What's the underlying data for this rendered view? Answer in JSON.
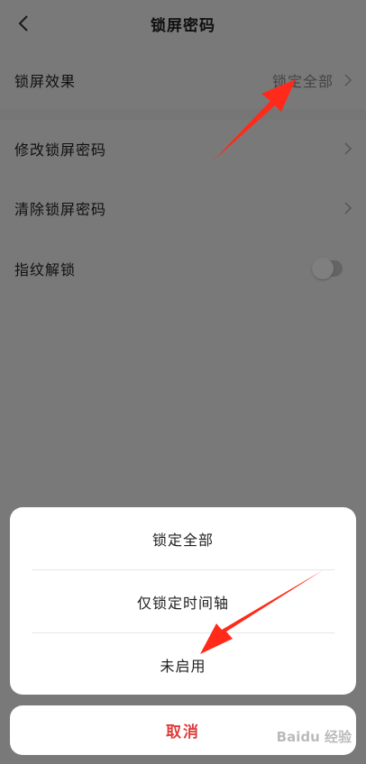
{
  "header": {
    "title": "锁屏密码"
  },
  "settings": {
    "lock_effect": {
      "label": "锁屏效果",
      "value": "锁定全部"
    },
    "change_password": {
      "label": "修改锁屏密码"
    },
    "clear_password": {
      "label": "清除锁屏密码"
    },
    "fingerprint": {
      "label": "指纹解锁",
      "enabled": false
    }
  },
  "action_sheet": {
    "options": [
      "锁定全部",
      "仅锁定时间轴",
      "未启用"
    ],
    "cancel_label": "取消"
  },
  "watermark": {
    "text": "Baidu 经验"
  },
  "colors": {
    "cancel_text": "#e03c3c",
    "annotation_arrow": "#ff2a1a",
    "overlay": "rgba(0,0,0,0.5)"
  }
}
